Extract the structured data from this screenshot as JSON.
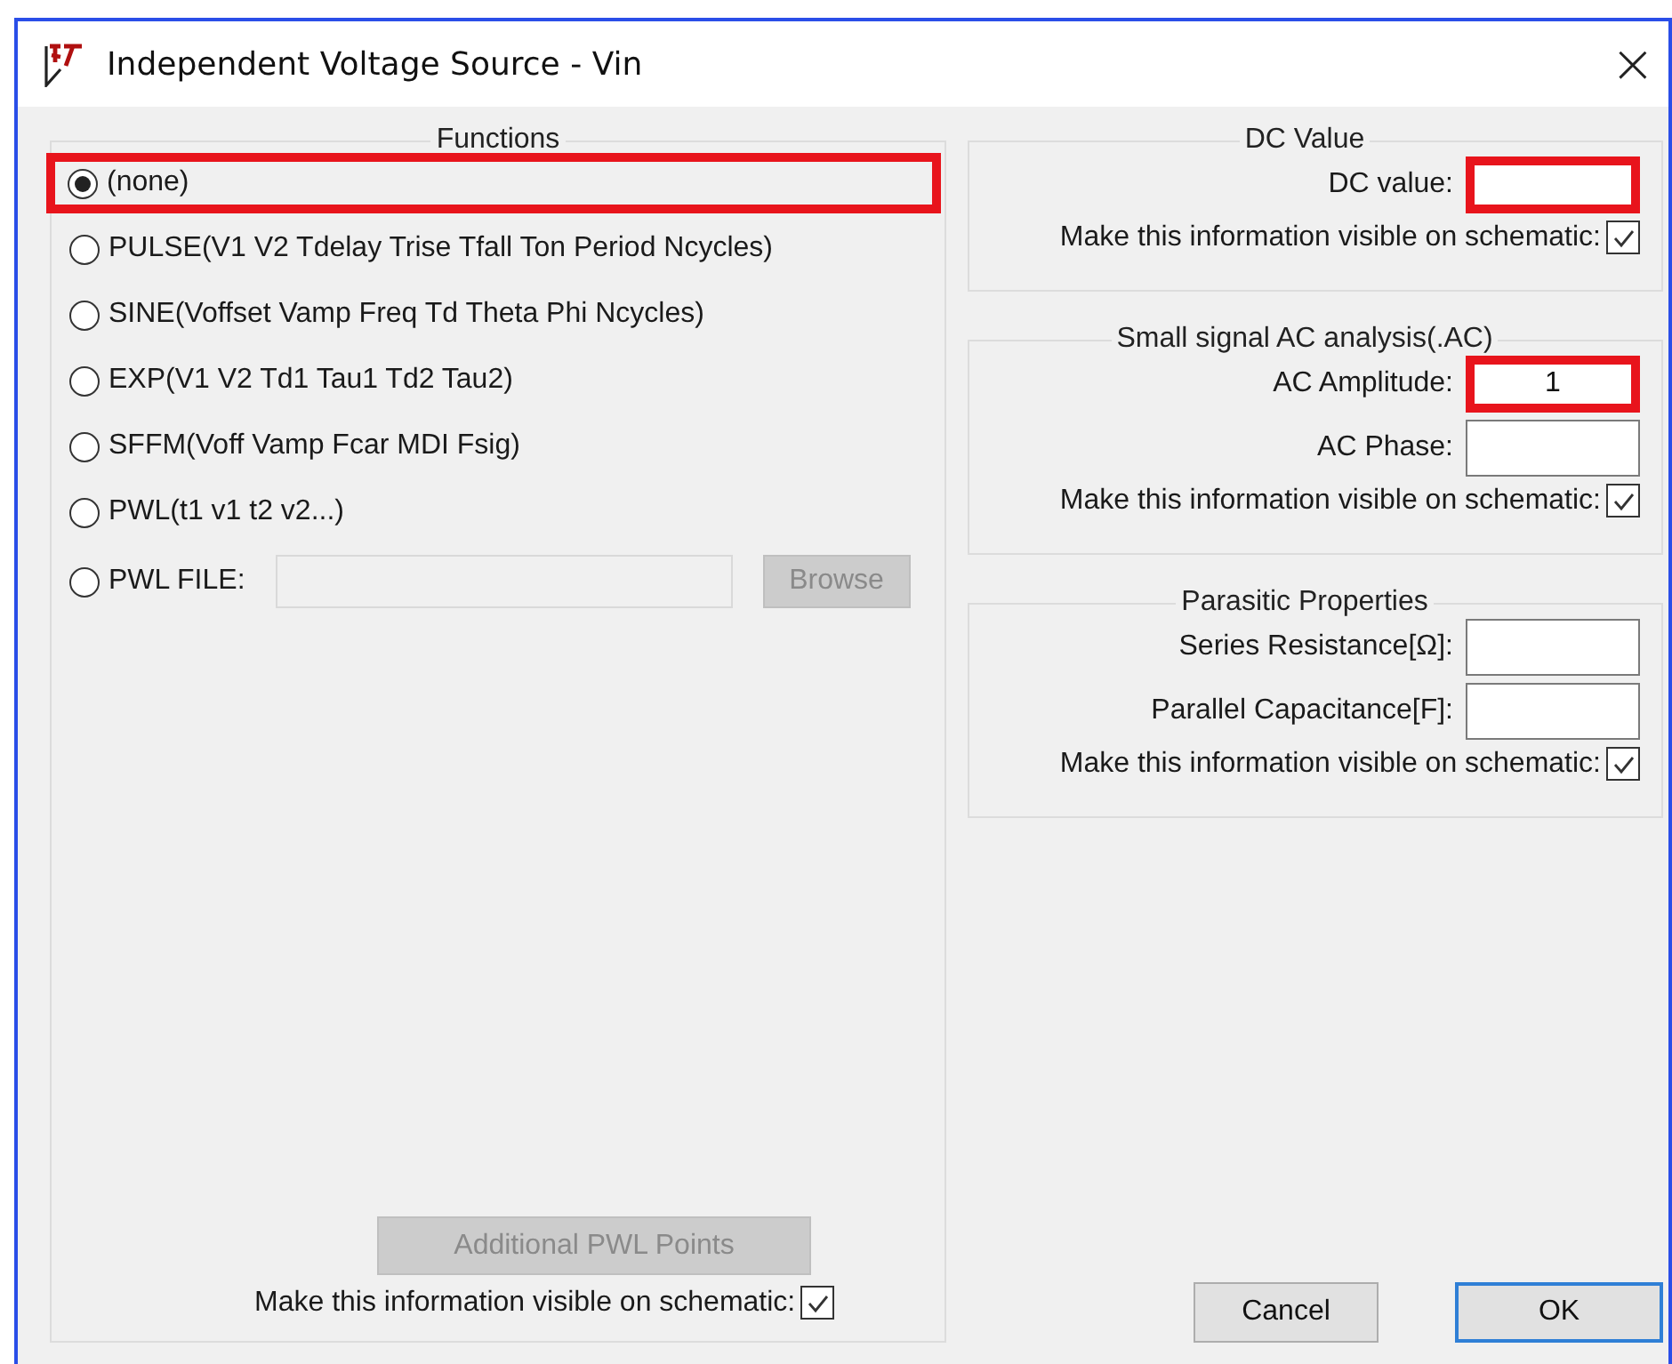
{
  "window": {
    "title": "Independent Voltage Source - Vin",
    "close": "×"
  },
  "functions": {
    "title": "Functions",
    "options": [
      {
        "kind": "radio",
        "label": "(none)",
        "selected": true,
        "highlighted": true
      },
      {
        "kind": "radio",
        "label": "PULSE(V1 V2 Tdelay Trise Tfall Ton Period Ncycles)",
        "selected": false,
        "highlighted": false
      },
      {
        "kind": "radio",
        "label": "SINE(Voffset Vamp Freq Td Theta Phi Ncycles)",
        "selected": false,
        "highlighted": false
      },
      {
        "kind": "radio",
        "label": "EXP(V1 V2 Td1 Tau1 Td2 Tau2)",
        "selected": false,
        "highlighted": false
      },
      {
        "kind": "radio",
        "label": "SFFM(Voff Vamp Fcar MDI Fsig)",
        "selected": false,
        "highlighted": false
      },
      {
        "kind": "radio",
        "label": "PWL(t1 v1 t2 v2...)",
        "selected": false,
        "highlighted": false
      },
      {
        "kind": "file",
        "label": "PWL FILE:",
        "selected": false,
        "highlighted": false,
        "button": "Browse",
        "button_disabled": true
      }
    ],
    "pwl_button": {
      "label": "Additional PWL Points",
      "disabled": true
    },
    "visible": {
      "label": "Make this information visible on schematic:",
      "checked": true
    }
  },
  "groups": [
    {
      "title": "DC Value",
      "rows": [
        {
          "kind": "field",
          "label": "DC value:",
          "value": "",
          "highlighted": true
        },
        {
          "kind": "checkbox",
          "label": "Make this information visible on schematic:",
          "checked": true
        }
      ]
    },
    {
      "title": "Small signal AC analysis(.AC)",
      "rows": [
        {
          "kind": "field",
          "label": "AC Amplitude:",
          "value": "1",
          "highlighted": true
        },
        {
          "kind": "field",
          "label": "AC Phase:",
          "value": "",
          "highlighted": false
        },
        {
          "kind": "checkbox",
          "label": "Make this information visible on schematic:",
          "checked": true
        }
      ]
    },
    {
      "title": "Parasitic Properties",
      "rows": [
        {
          "kind": "field",
          "label": "Series Resistance[Ω]:",
          "value": "",
          "highlighted": false
        },
        {
          "kind": "field",
          "label": "Parallel Capacitance[F]:",
          "value": "",
          "highlighted": false
        },
        {
          "kind": "checkbox",
          "label": "Make this information visible on schematic:",
          "checked": true
        }
      ]
    }
  ],
  "buttons": [
    {
      "label": "Cancel",
      "default": false
    },
    {
      "label": "OK",
      "default": true
    }
  ]
}
